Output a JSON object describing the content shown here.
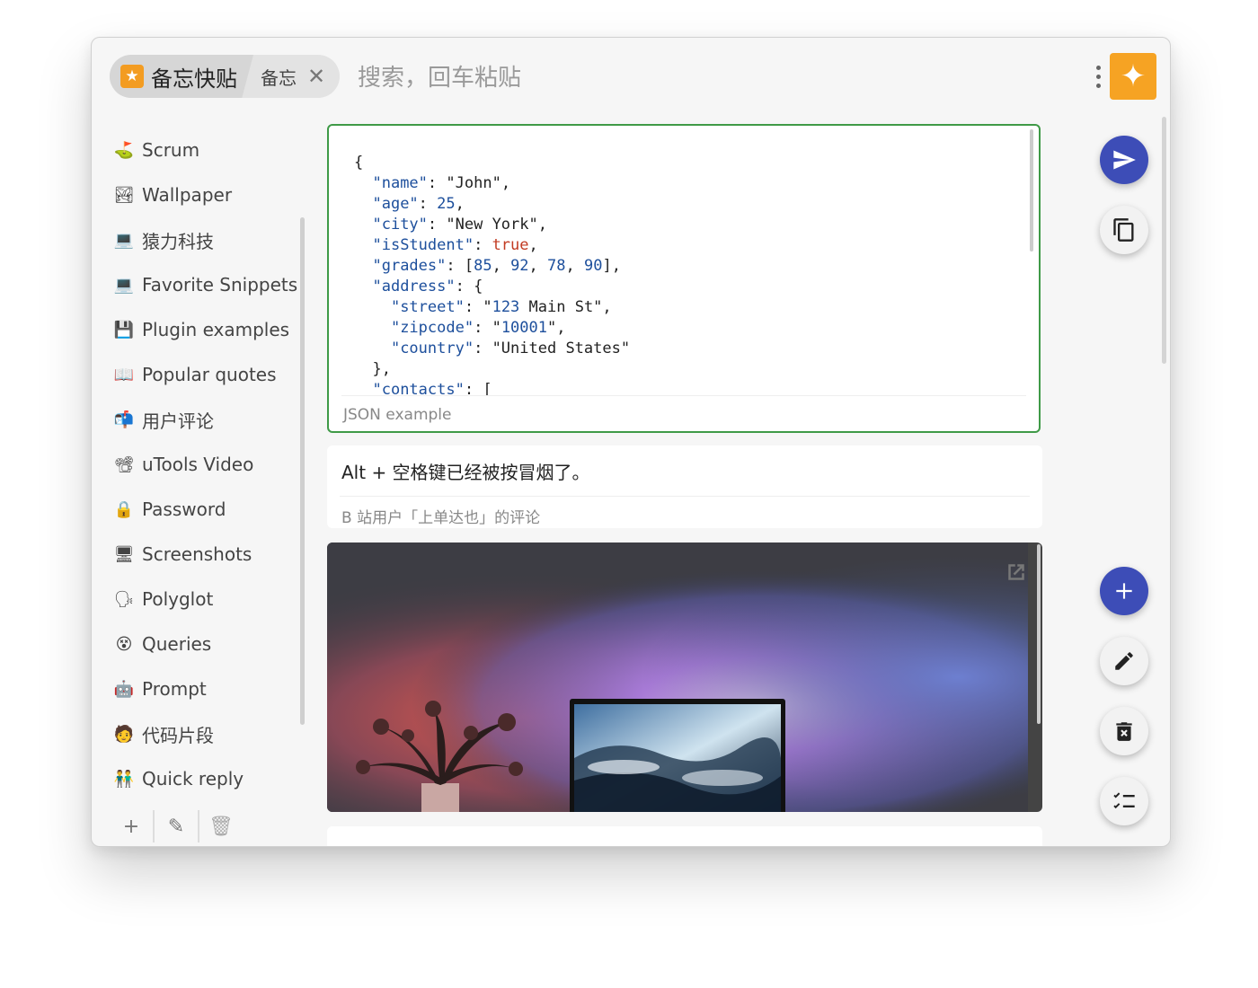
{
  "header": {
    "app_name": "备忘快贴",
    "app_logo_icon": "star-logo-icon",
    "sub_tag": "备忘",
    "search_placeholder": "搜索，回车粘贴"
  },
  "sidebar": {
    "items": [
      {
        "label": "Scrum",
        "icon": "⛳"
      },
      {
        "label": "Wallpaper",
        "icon": "🏞"
      },
      {
        "label": "猿力科技",
        "icon": "💻"
      },
      {
        "label": "Favorite Snippets",
        "icon": "💻"
      },
      {
        "label": "Plugin examples",
        "icon": "💾"
      },
      {
        "label": "Popular quotes",
        "icon": "📖"
      },
      {
        "label": "用户评论",
        "icon": "📬"
      },
      {
        "label": "uTools Video",
        "icon": "📽"
      },
      {
        "label": "Password",
        "icon": "🔒"
      },
      {
        "label": "Screenshots",
        "icon": "🖥"
      },
      {
        "label": "Polyglot",
        "icon": "🗣"
      },
      {
        "label": "Queries",
        "icon": "😵"
      },
      {
        "label": "Prompt",
        "icon": "🤖"
      },
      {
        "label": "代码片段",
        "icon": "🧑"
      },
      {
        "label": "Quick reply",
        "icon": "👬"
      }
    ],
    "actions": {
      "add": "+",
      "edit": "✎",
      "delete": "🗑"
    }
  },
  "cards": {
    "json": {
      "code_lines": [
        "{",
        "  \"name\": \"John\",",
        "  \"age\": 25,",
        "  \"city\": \"New York\",",
        "  \"isStudent\": true,",
        "  \"grades\": [85, 92, 78, 90],",
        "  \"address\": {",
        "    \"street\": \"123 Main St\",",
        "    \"zipcode\": \"10001\",",
        "    \"country\": \"United States\"",
        "  },",
        "  \"contacts\": ["
      ],
      "description": "JSON example"
    },
    "text": {
      "title": "Alt + 空格键已经被按冒烟了。",
      "description": "B 站用户「上单达也」的评论"
    },
    "image": {
      "description": "wallpaper photo: flowers vase and laptop against purple-red glowing wall"
    }
  },
  "fabs": {
    "send": "send-icon",
    "copy": "copy-icon",
    "add": "add-icon",
    "edit": "edit-icon",
    "delete": "delete-icon",
    "select": "checklist-icon"
  },
  "colors": {
    "accent": "#3d4db7",
    "selected_border": "#3f9a47",
    "logo_orange": "#f6a323"
  }
}
